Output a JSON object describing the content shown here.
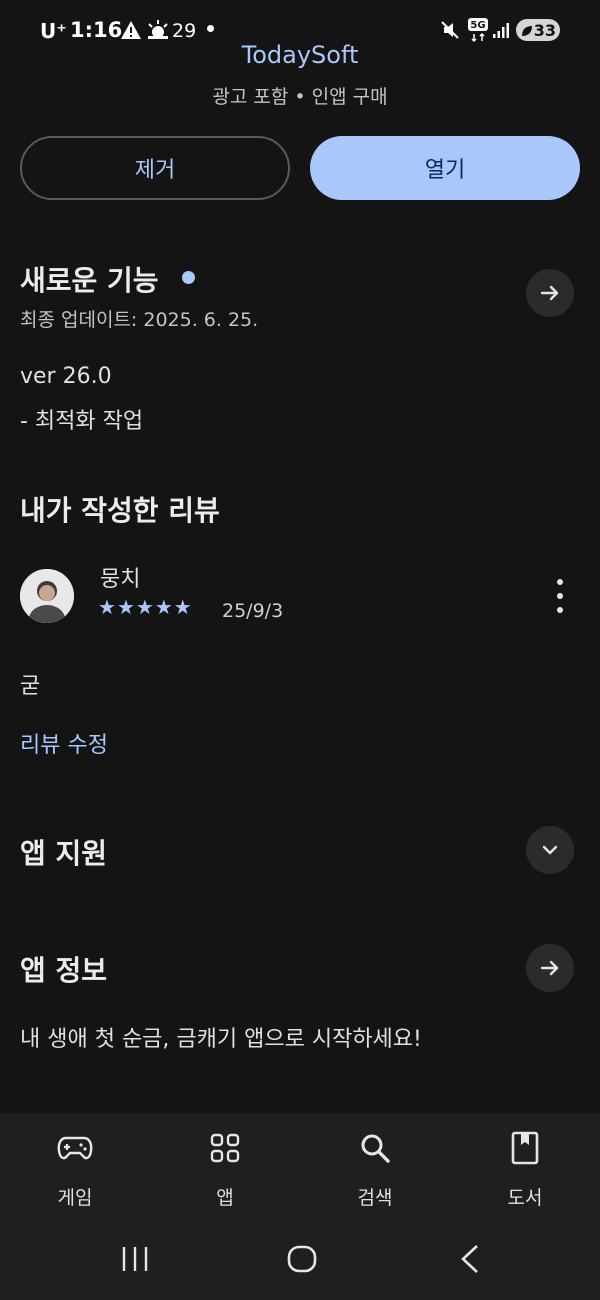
{
  "status_bar": {
    "carrier": "U⁺",
    "time": "1:16",
    "temperature": "29",
    "network": "5G",
    "battery": "33"
  },
  "header": {
    "app_name": "TodaySoft",
    "meta": "광고 포함 • 인앱 구매",
    "remove_label": "제거",
    "open_label": "열기"
  },
  "whats_new": {
    "title": "새로운 기능",
    "last_updated": "최종 업데이트: 2025. 6. 25.",
    "version": "ver 26.0",
    "note": "- 최적화 작업"
  },
  "my_review": {
    "title": "내가 작성한 리뷰",
    "author": "뭉치",
    "rating": 5,
    "date": "25/9/3",
    "text": "굳",
    "edit_label": "리뷰 수정"
  },
  "app_support": {
    "title": "앱 지원"
  },
  "app_info": {
    "title": "앱 정보",
    "description": "내 생애 첫 순금, 금캐기 앱으로 시작하세요!"
  },
  "bottom_nav": {
    "items": [
      {
        "label": "게임",
        "icon": "gamepad-icon"
      },
      {
        "label": "앱",
        "icon": "apps-grid-icon"
      },
      {
        "label": "검색",
        "icon": "search-icon"
      },
      {
        "label": "도서",
        "icon": "book-icon"
      }
    ]
  },
  "colors": {
    "background": "#141414",
    "accent": "#a8c7fa",
    "nav_background": "#1f1f1f"
  }
}
